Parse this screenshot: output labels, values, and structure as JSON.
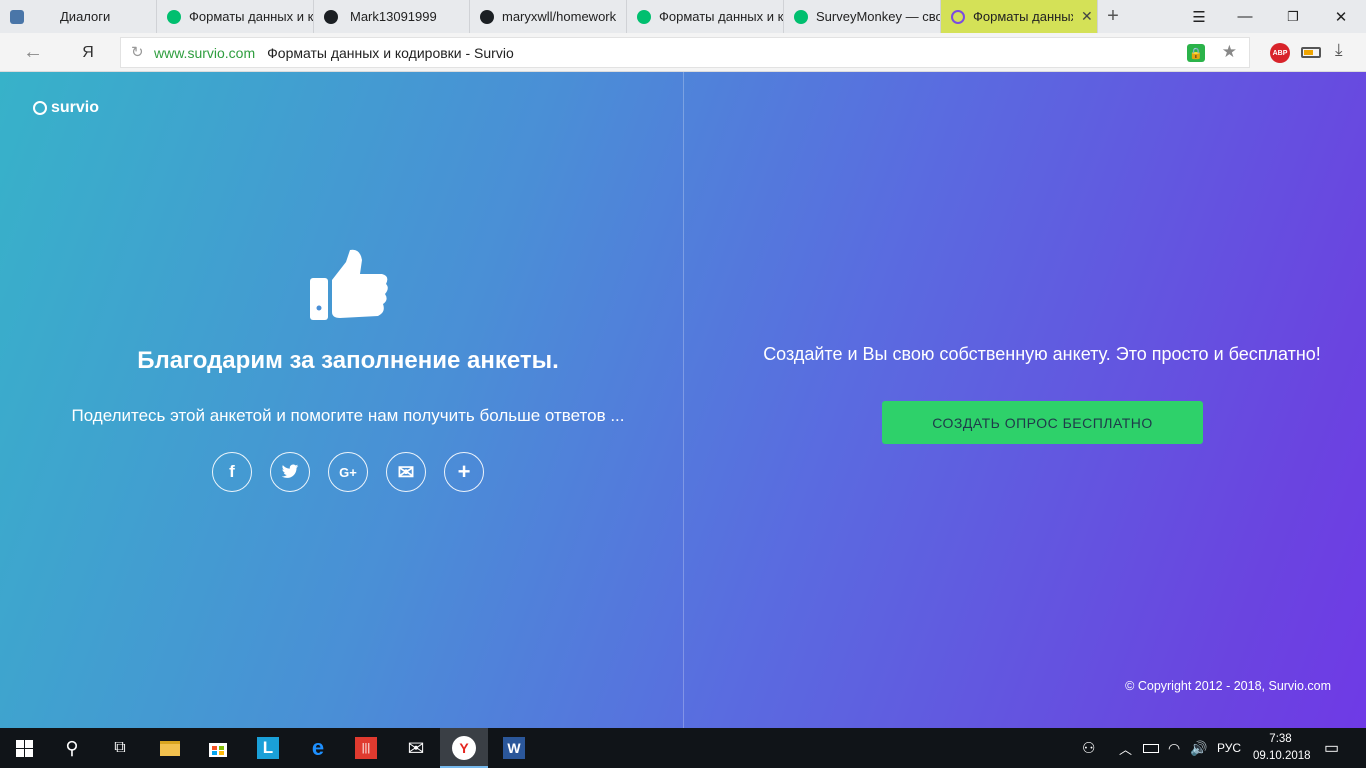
{
  "browser": {
    "tabs": [
      {
        "title": "Диалоги",
        "icon": "dialogs-icon"
      },
      {
        "title": "Форматы данных и к",
        "icon": "surveymonkey-icon"
      },
      {
        "title": "Mark13091999",
        "icon": "github-icon"
      },
      {
        "title": "maryxwll/homework",
        "icon": "github-icon"
      },
      {
        "title": "Форматы данных и к",
        "icon": "surveymonkey-icon"
      },
      {
        "title": "SurveyMonkey — сво",
        "icon": "surveymonkey-icon"
      },
      {
        "title": "Форматы данных",
        "icon": "survio-icon",
        "active": true
      }
    ],
    "address": {
      "domain": "www.survio.com",
      "page_title": "Форматы данных и кодировки - Survio",
      "yandex_glyph": "Я",
      "abp_label": "ABP"
    }
  },
  "page": {
    "logo": "survio",
    "thanks": "Благодарим за заполнение анкеты.",
    "share_text": "Поделитесь этой анкетой и помогите нам получить больше ответов ...",
    "social": [
      {
        "icon": "facebook-icon",
        "glyph": "f"
      },
      {
        "icon": "twitter-icon",
        "glyph": "🐦"
      },
      {
        "icon": "google-plus-icon",
        "glyph": "G+"
      },
      {
        "icon": "email-icon",
        "glyph": "✉"
      },
      {
        "icon": "plus-icon",
        "glyph": "+"
      }
    ],
    "cta_text": "Создайте и Вы свою собственную анкету. Это просто и бесплатно!",
    "cta_button": "СОЗДАТЬ ОПРОС БЕСПЛАТНО",
    "copyright": "© Copyright 2012 - 2018, Survio.com"
  },
  "taskbar": {
    "language": "РУС",
    "time": "7:38",
    "date": "09.10.2018"
  },
  "colors": {
    "cta_green": "#2ed16a",
    "active_tab": "#d4e157",
    "gradient_start": "#37b2c9",
    "gradient_end": "#6f3ae6"
  }
}
